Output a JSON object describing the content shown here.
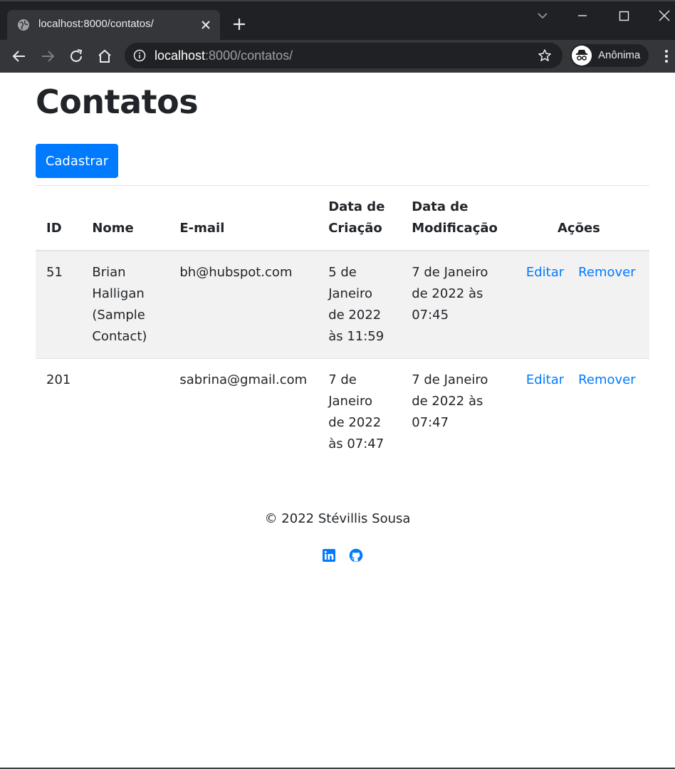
{
  "browser": {
    "tab_title": "localhost:8000/contatos/",
    "url_host": "localhost",
    "url_rest": ":8000/contatos/",
    "profile_label": "Anônima"
  },
  "page": {
    "title": "Contatos",
    "primary_button": "Cadastrar",
    "table": {
      "headers": {
        "id": "ID",
        "name": "Nome",
        "email": "E-mail",
        "created": "Data de Criação",
        "modified": "Data de Modificação",
        "actions": "Ações"
      },
      "rows": [
        {
          "id": "51",
          "name": "Brian Halligan (Sample Contact)",
          "email": "bh@hubspot.com",
          "created": "5 de Janeiro de 2022 às 11:59",
          "modified": "7 de Janeiro de 2022 às 07:45",
          "edit": "Editar",
          "remove": "Remover"
        },
        {
          "id": "201",
          "name": "",
          "email": "sabrina@gmail.com",
          "created": "7 de Janeiro de 2022 às 07:47",
          "modified": "7 de Janeiro de 2022 às 07:47",
          "edit": "Editar",
          "remove": "Remover"
        }
      ]
    },
    "footer": "© 2022 Stévillis Sousa",
    "social_icons": [
      "linkedin-icon",
      "github-icon"
    ]
  },
  "colors": {
    "primary": "#007bff",
    "chrome_dark": "#202124",
    "chrome_toolbar": "#35363a",
    "stripe": "#f2f2f2"
  }
}
